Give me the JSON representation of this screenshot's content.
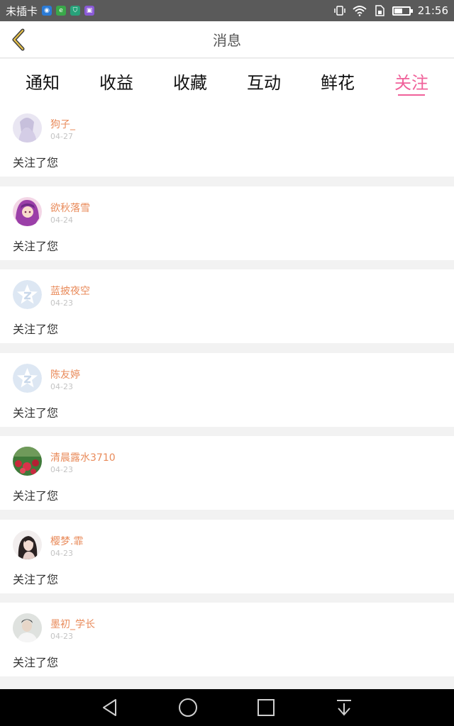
{
  "status_bar": {
    "carrier": "未插卡",
    "time": "21:56",
    "battery_level": 0.55
  },
  "header": {
    "title": "消息"
  },
  "tabs": [
    {
      "label": "通知",
      "active": false
    },
    {
      "label": "收益",
      "active": false
    },
    {
      "label": "收藏",
      "active": false
    },
    {
      "label": "互动",
      "active": false
    },
    {
      "label": "鲜花",
      "active": false
    },
    {
      "label": "关注",
      "active": true
    }
  ],
  "notifications": [
    {
      "user": "狗子_",
      "date": "04-27",
      "text": "关注了您",
      "avatar": "anime-girl-avatar"
    },
    {
      "user": "欲秋落雪",
      "date": "04-24",
      "text": "关注了您",
      "avatar": "anime-purple-hair-avatar"
    },
    {
      "user": "蓝披夜空",
      "date": "04-23",
      "text": "关注了您",
      "avatar": "default-star-avatar"
    },
    {
      "user": "陈友婷",
      "date": "04-23",
      "text": "关注了您",
      "avatar": "default-star-avatar"
    },
    {
      "user": "清晨露水3710",
      "date": "04-23",
      "text": "关注了您",
      "avatar": "garden-flowers-avatar"
    },
    {
      "user": "樱梦.霏",
      "date": "04-23",
      "text": "关注了您",
      "avatar": "woman-portrait-avatar"
    },
    {
      "user": "墨初_学长",
      "date": "04-23",
      "text": "关注了您",
      "avatar": "man-portrait-avatar"
    }
  ],
  "colors": {
    "accent": "#f0619a",
    "username": "#e98b5b",
    "back_arrow": "#c8a23a"
  }
}
